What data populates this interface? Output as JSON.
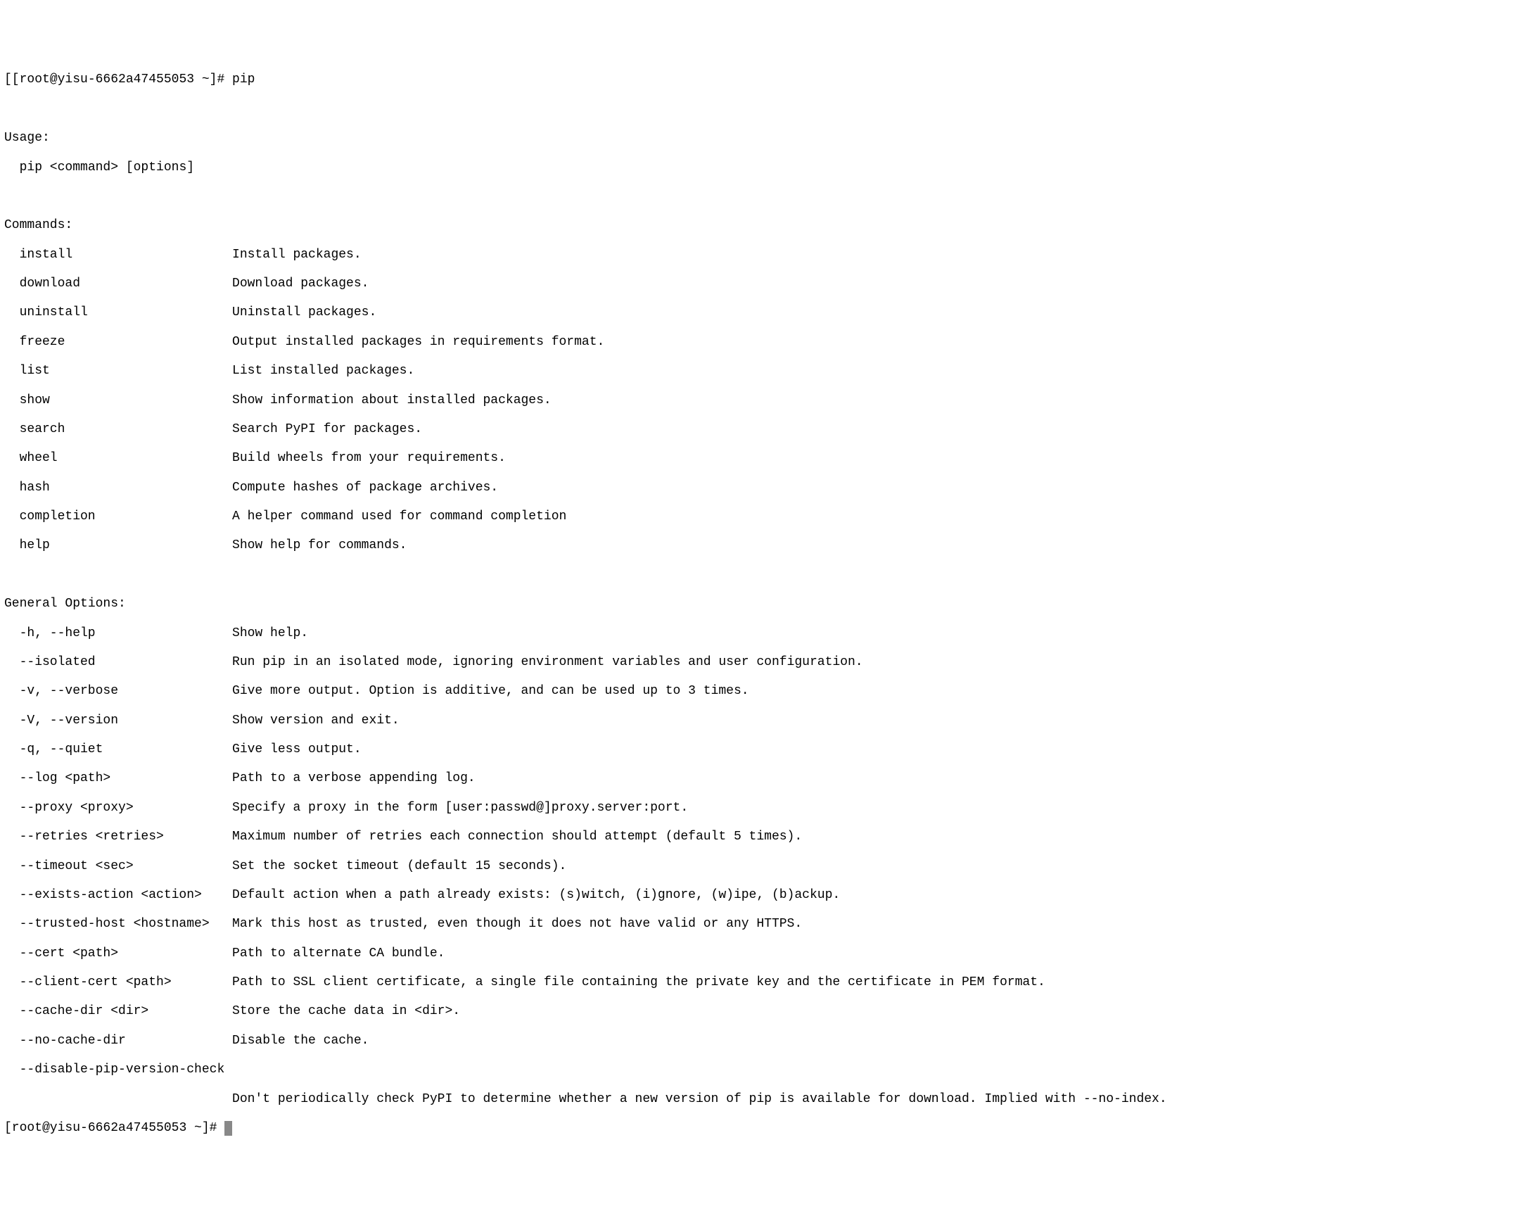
{
  "prompt1": "[[root@yisu-6662a47455053 ~]# pip",
  "blank": " ",
  "usage_header": "Usage:",
  "usage_line": "  pip <command> [options]",
  "commands_header": "Commands:",
  "commands": [
    {
      "name": "install",
      "desc": "Install packages."
    },
    {
      "name": "download",
      "desc": "Download packages."
    },
    {
      "name": "uninstall",
      "desc": "Uninstall packages."
    },
    {
      "name": "freeze",
      "desc": "Output installed packages in requirements format."
    },
    {
      "name": "list",
      "desc": "List installed packages."
    },
    {
      "name": "show",
      "desc": "Show information about installed packages."
    },
    {
      "name": "search",
      "desc": "Search PyPI for packages."
    },
    {
      "name": "wheel",
      "desc": "Build wheels from your requirements."
    },
    {
      "name": "hash",
      "desc": "Compute hashes of package archives."
    },
    {
      "name": "completion",
      "desc": "A helper command used for command completion"
    },
    {
      "name": "help",
      "desc": "Show help for commands."
    }
  ],
  "options_header": "General Options:",
  "options": [
    {
      "name": "-h, --help",
      "desc": "Show help."
    },
    {
      "name": "--isolated",
      "desc": "Run pip in an isolated mode, ignoring environment variables and user configuration."
    },
    {
      "name": "-v, --verbose",
      "desc": "Give more output. Option is additive, and can be used up to 3 times."
    },
    {
      "name": "-V, --version",
      "desc": "Show version and exit."
    },
    {
      "name": "-q, --quiet",
      "desc": "Give less output."
    },
    {
      "name": "--log <path>",
      "desc": "Path to a verbose appending log."
    },
    {
      "name": "--proxy <proxy>",
      "desc": "Specify a proxy in the form [user:passwd@]proxy.server:port."
    },
    {
      "name": "--retries <retries>",
      "desc": "Maximum number of retries each connection should attempt (default 5 times)."
    },
    {
      "name": "--timeout <sec>",
      "desc": "Set the socket timeout (default 15 seconds)."
    },
    {
      "name": "--exists-action <action>",
      "desc": "Default action when a path already exists: (s)witch, (i)gnore, (w)ipe, (b)ackup."
    },
    {
      "name": "--trusted-host <hostname>",
      "desc": "Mark this host as trusted, even though it does not have valid or any HTTPS."
    },
    {
      "name": "--cert <path>",
      "desc": "Path to alternate CA bundle."
    },
    {
      "name": "--client-cert <path>",
      "desc": "Path to SSL client certificate, a single file containing the private key and the certificate in PEM format."
    },
    {
      "name": "--cache-dir <dir>",
      "desc": "Store the cache data in <dir>."
    },
    {
      "name": "--no-cache-dir",
      "desc": "Disable the cache."
    },
    {
      "name": "--disable-pip-version-check",
      "desc": ""
    }
  ],
  "wrapped_desc": "Don't periodically check PyPI to determine whether a new version of pip is available for download. Implied with --no-index.",
  "prompt2": "[root@yisu-6662a47455053 ~]# "
}
